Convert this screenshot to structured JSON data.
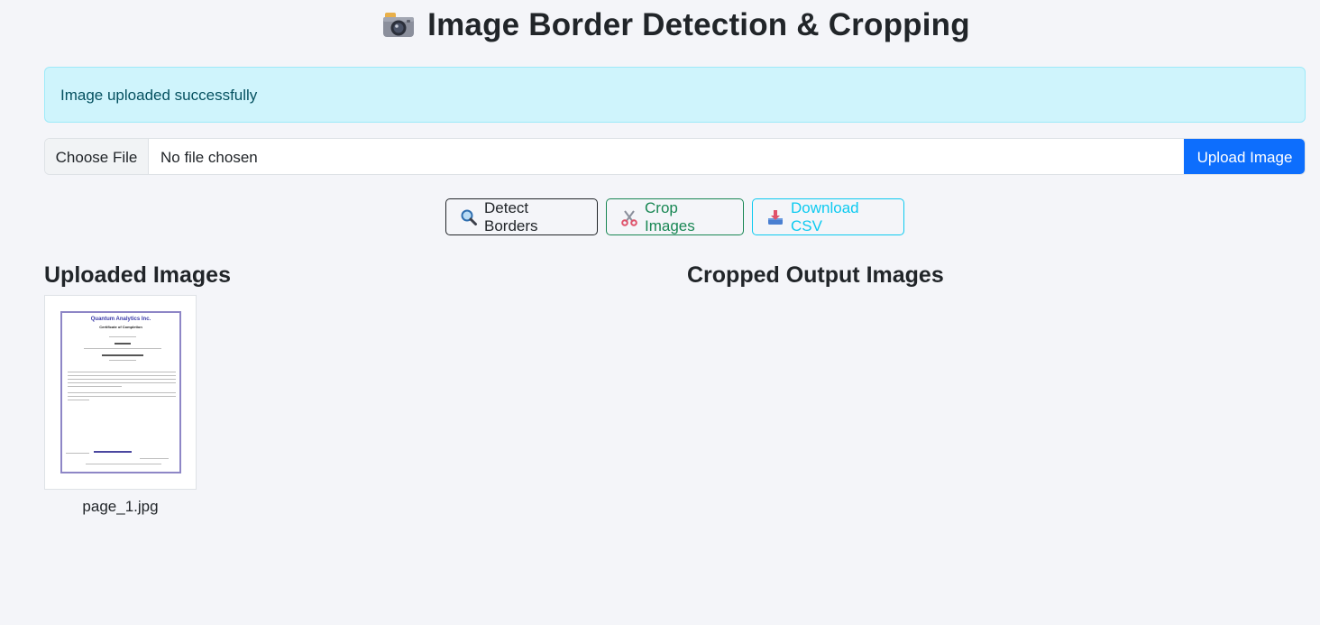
{
  "header": {
    "icon": "camera-icon",
    "title": "Image Border Detection & Cropping"
  },
  "alert": {
    "message": "Image uploaded successfully",
    "color": "#cff4fc"
  },
  "upload": {
    "choose_label": "Choose File",
    "file_status": "No file chosen",
    "upload_label": "Upload Image",
    "accent": "#0d6efd"
  },
  "actions": {
    "detect": {
      "label": "Detect Borders",
      "icon": "magnifier-icon",
      "color": "#212529"
    },
    "crop": {
      "label": "Crop Images",
      "icon": "scissors-icon",
      "color": "#198754"
    },
    "download": {
      "label": "Download CSV",
      "icon": "inbox-tray-icon",
      "color": "#0dcaf0"
    }
  },
  "uploaded": {
    "heading": "Uploaded Images",
    "items": [
      {
        "filename": "page_1.jpg",
        "preview": {
          "company": "Quantum Analytics Inc.",
          "subtitle": "Certificate of Completion"
        }
      }
    ]
  },
  "cropped": {
    "heading": "Cropped Output Images",
    "items": []
  }
}
